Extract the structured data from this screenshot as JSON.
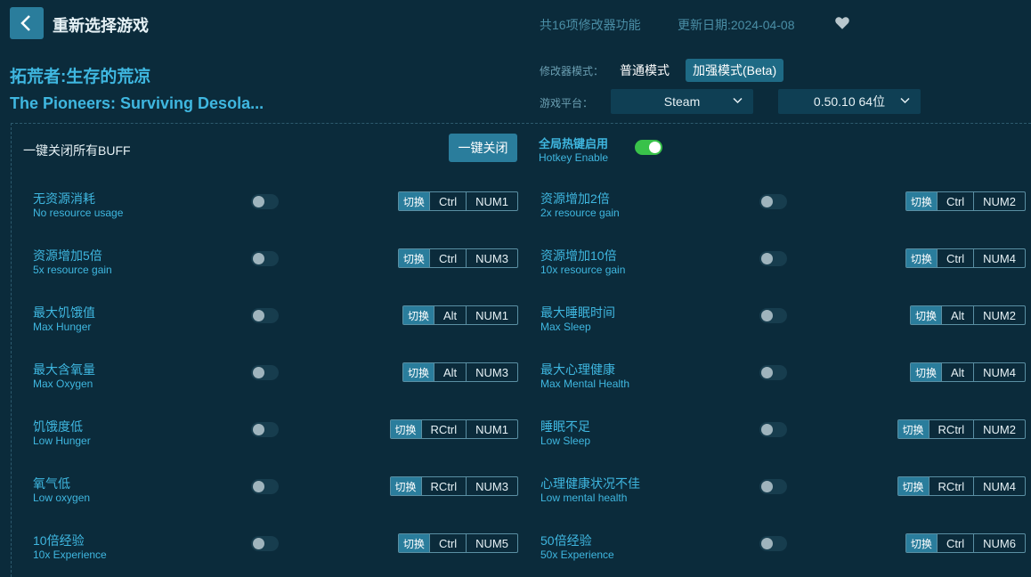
{
  "header": {
    "title": "重新选择游戏",
    "feature_count": "共16项修改器功能",
    "update_date": "更新日期:2024-04-08"
  },
  "game": {
    "title_cn": "拓荒者:生存的荒凉",
    "title_en": "The Pioneers: Surviving Desola..."
  },
  "mode": {
    "label": "修改器模式：",
    "normal": "普通模式",
    "enhanced": "加强模式(Beta)",
    "selected": "enhanced"
  },
  "platform": {
    "label": "游戏平台：",
    "selected": "Steam",
    "version": "0.50.10 64位"
  },
  "global": {
    "buff_label": "一键关闭所有BUFF",
    "close_all_button": "一键关闭",
    "hotkey_cn": "全局热键启用",
    "hotkey_en": "Hotkey Enable",
    "hotkey_enabled": true
  },
  "icons": {
    "back": "chevron-left-icon",
    "heart": "heart-icon",
    "dropdown": "chevron-down-icon"
  },
  "colors": {
    "background": "#0b2b3b",
    "accent": "#3fb7e0",
    "button": "#2a7d9c",
    "switch_on": "#39c24a"
  },
  "options": [
    {
      "cn": "无资源消耗",
      "en": "No resource usage",
      "tag": "切换",
      "mod": "Ctrl",
      "key": "NUM1",
      "on": false
    },
    {
      "cn": "资源增加2倍",
      "en": "2x resource gain",
      "tag": "切换",
      "mod": "Ctrl",
      "key": "NUM2",
      "on": false
    },
    {
      "cn": "资源增加5倍",
      "en": "5x resource gain",
      "tag": "切换",
      "mod": "Ctrl",
      "key": "NUM3",
      "on": false
    },
    {
      "cn": "资源增加10倍",
      "en": "10x resource gain",
      "tag": "切换",
      "mod": "Ctrl",
      "key": "NUM4",
      "on": false
    },
    {
      "cn": "最大饥饿值",
      "en": "Max Hunger",
      "tag": "切换",
      "mod": "Alt",
      "key": "NUM1",
      "on": false
    },
    {
      "cn": "最大睡眠时间",
      "en": "Max Sleep",
      "tag": "切换",
      "mod": "Alt",
      "key": "NUM2",
      "on": false
    },
    {
      "cn": "最大含氧量",
      "en": "Max Oxygen",
      "tag": "切换",
      "mod": "Alt",
      "key": "NUM3",
      "on": false
    },
    {
      "cn": "最大心理健康",
      "en": "Max Mental Health",
      "tag": "切换",
      "mod": "Alt",
      "key": "NUM4",
      "on": false
    },
    {
      "cn": "饥饿度低",
      "en": "Low Hunger",
      "tag": "切换",
      "mod": "RCtrl",
      "key": "NUM1",
      "on": false
    },
    {
      "cn": "睡眠不足",
      "en": "Low Sleep",
      "tag": "切换",
      "mod": "RCtrl",
      "key": "NUM2",
      "on": false
    },
    {
      "cn": "氧气低",
      "en": "Low oxygen",
      "tag": "切换",
      "mod": "RCtrl",
      "key": "NUM3",
      "on": false
    },
    {
      "cn": "心理健康状况不佳",
      "en": "Low mental health",
      "tag": "切换",
      "mod": "RCtrl",
      "key": "NUM4",
      "on": false
    },
    {
      "cn": "10倍经验",
      "en": "10x Experience",
      "tag": "切换",
      "mod": "Ctrl",
      "key": "NUM5",
      "on": false
    },
    {
      "cn": "50倍经验",
      "en": "50x Experience",
      "tag": "切换",
      "mod": "Ctrl",
      "key": "NUM6",
      "on": false
    }
  ]
}
